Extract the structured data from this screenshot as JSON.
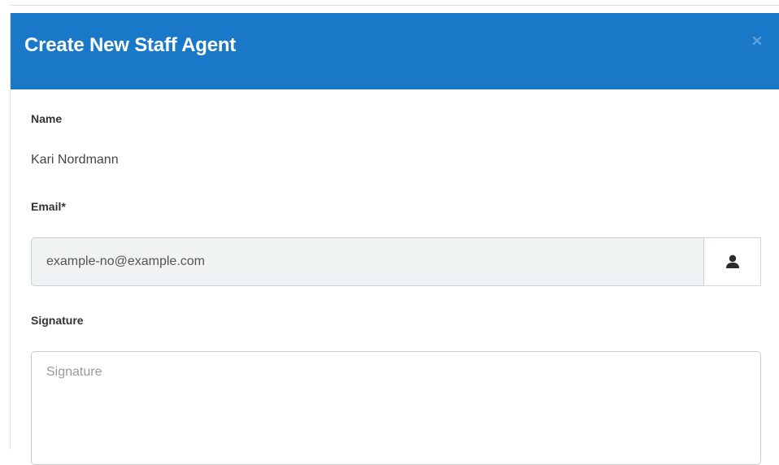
{
  "modal": {
    "title": "Create New Staff Agent",
    "close_icon": "close-icon"
  },
  "form": {
    "name": {
      "label": "Name",
      "value": "Kari Nordmann"
    },
    "email": {
      "label": "Email*",
      "value": "example-no@example.com",
      "addon_icon": "user-icon"
    },
    "signature": {
      "label": "Signature",
      "placeholder": "Signature",
      "value": ""
    }
  },
  "colors": {
    "header_bg": "#1a78c9",
    "header_text": "#ffffff",
    "input_readonly_bg": "#f0f3f4"
  }
}
